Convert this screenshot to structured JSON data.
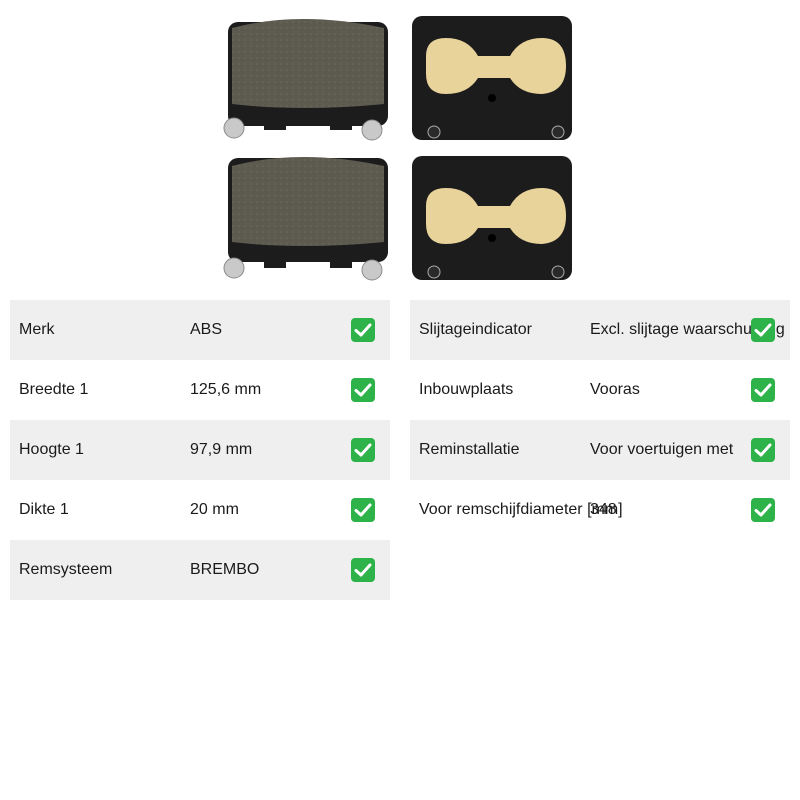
{
  "product_image": {
    "description_icon": "brake-pad-set-icon"
  },
  "specs_left": [
    {
      "label": "Merk",
      "value": "ABS"
    },
    {
      "label": "Breedte 1",
      "value": "125,6 mm"
    },
    {
      "label": "Hoogte 1",
      "value": "97,9 mm"
    },
    {
      "label": "Dikte 1",
      "value": "20 mm"
    },
    {
      "label": "Remsysteem",
      "value": "BREMBO"
    }
  ],
  "specs_right": [
    {
      "label": "Slijtageindicator",
      "value": "Excl. slijtage waarschuwing"
    },
    {
      "label": "Inbouwplaats",
      "value": "Vooras"
    },
    {
      "label": "Reminstallatie",
      "value": "Voor voertuigen met"
    },
    {
      "label": "Voor remschijfdiameter [mm]",
      "value": "348"
    }
  ],
  "check_color": "#2db34a"
}
